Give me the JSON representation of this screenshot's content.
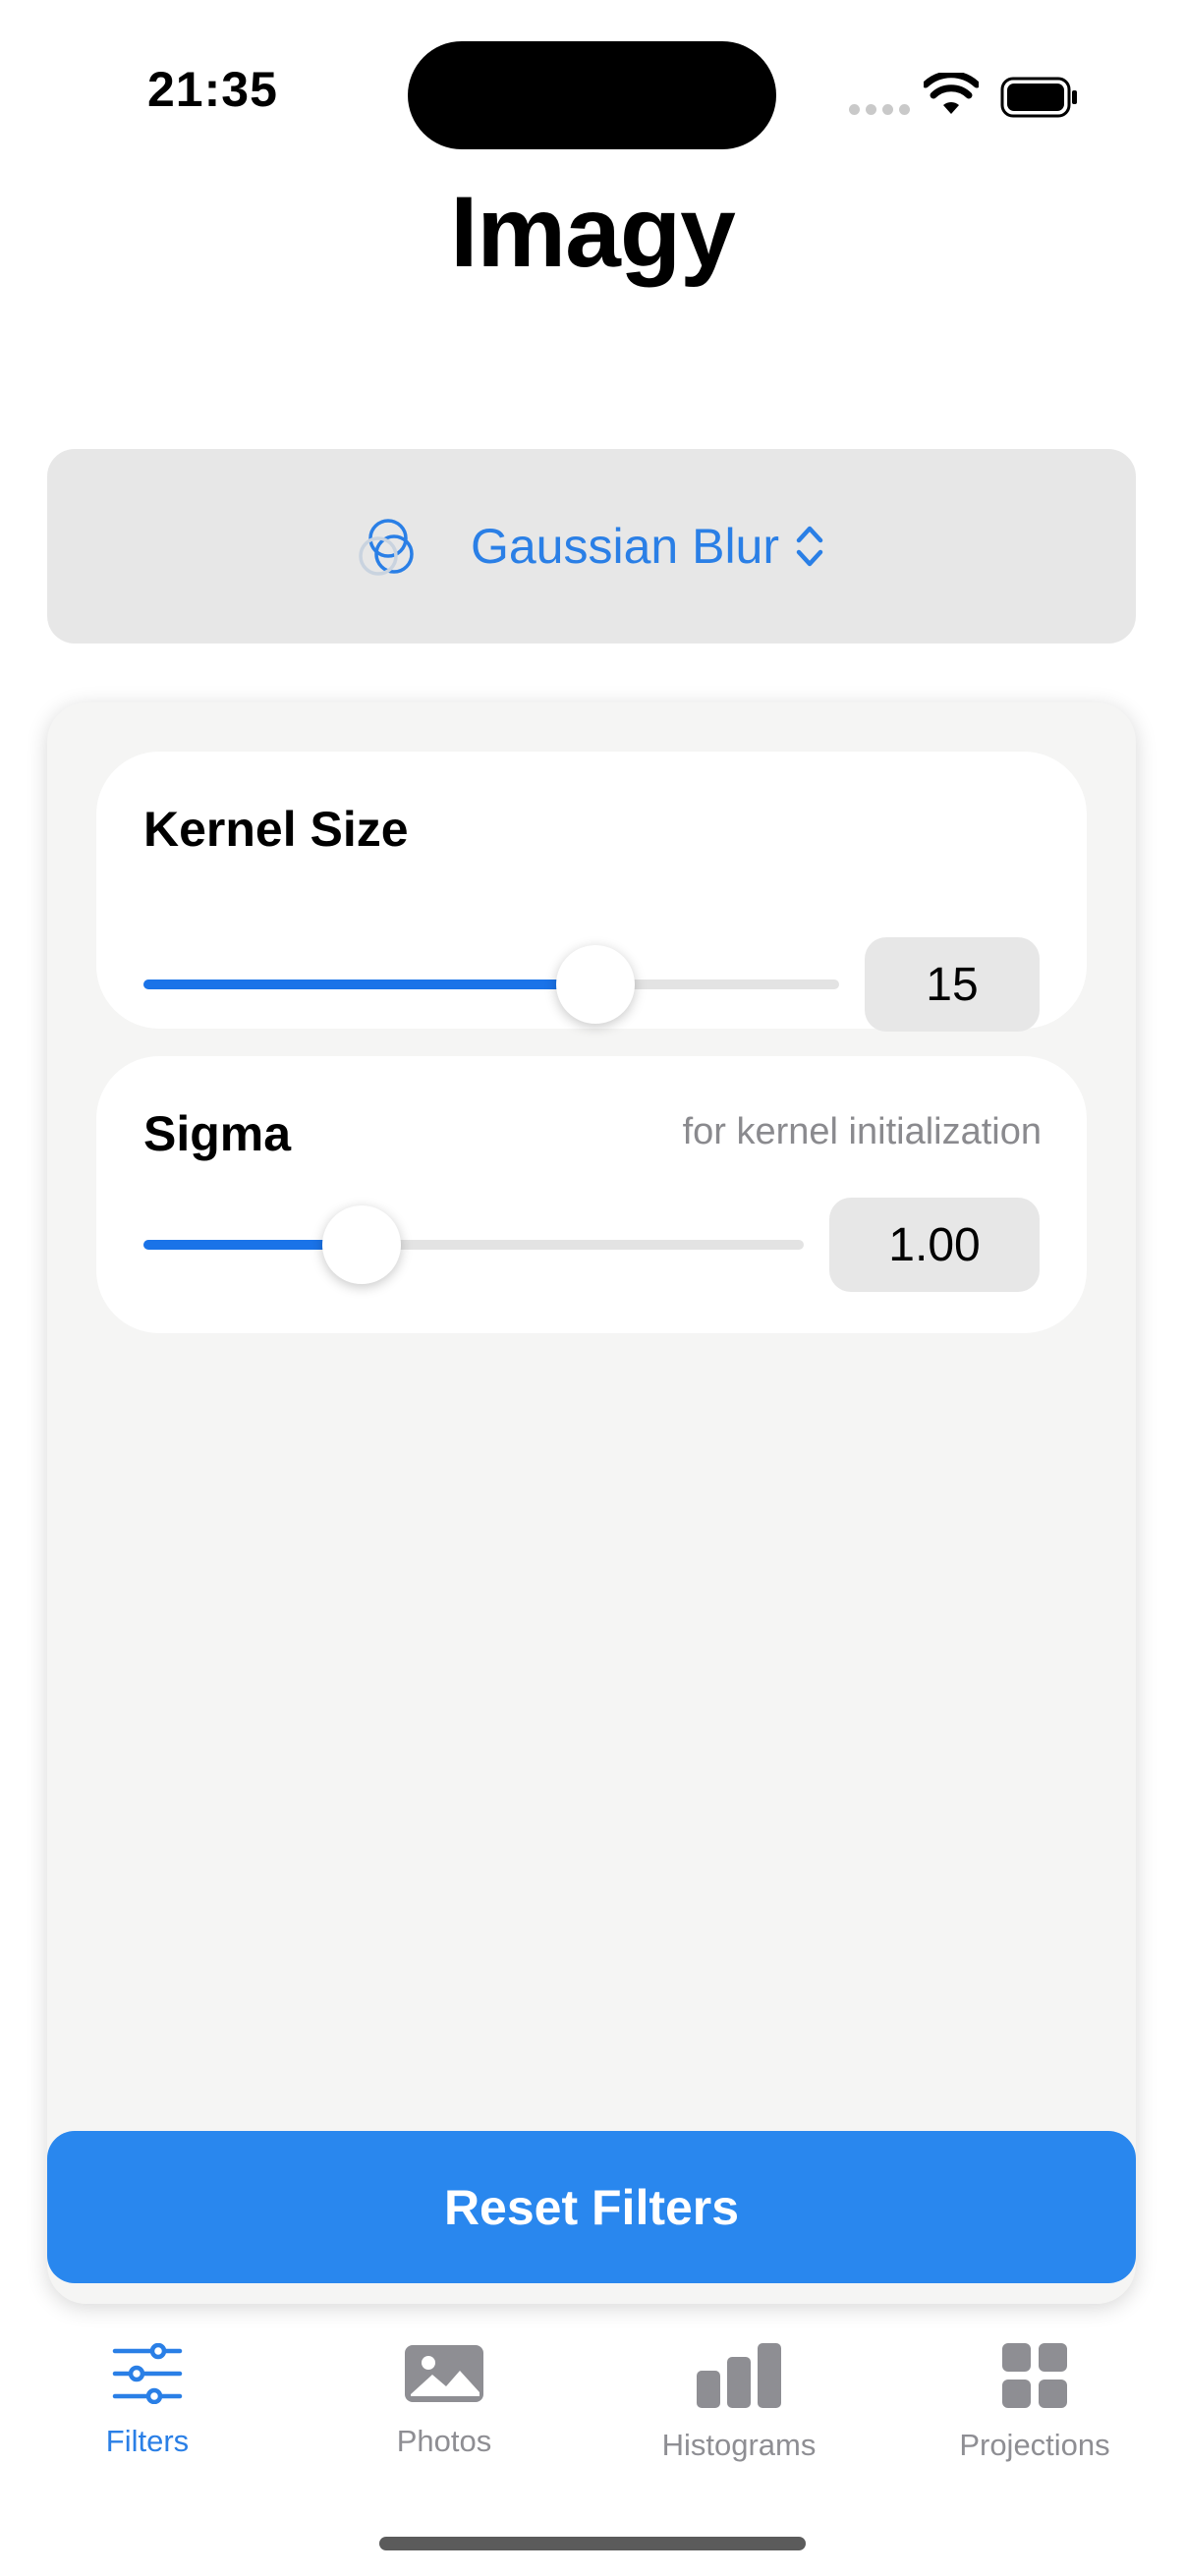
{
  "status_bar": {
    "time": "21:35"
  },
  "app": {
    "title": "Imagy"
  },
  "filter_selector": {
    "label": "Gaussian Blur",
    "icon": "blur-circles-icon"
  },
  "params": {
    "kernel_size": {
      "title": "Kernel Size",
      "value": "15",
      "slider_fraction": 0.65
    },
    "sigma": {
      "title": "Sigma",
      "subtitle": "for kernel initialization",
      "value": "1.00",
      "slider_fraction": 0.33
    }
  },
  "reset_button": {
    "label": "Reset Filters"
  },
  "tabs": [
    {
      "label": "Filters",
      "icon": "sliders-icon",
      "active": true
    },
    {
      "label": "Photos",
      "icon": "photo-icon",
      "active": false
    },
    {
      "label": "Histograms",
      "icon": "bar-chart-icon",
      "active": false
    },
    {
      "label": "Projections",
      "icon": "grid-icon",
      "active": false
    }
  ],
  "colors": {
    "accent": "#2A7FE6",
    "button": "#2987EE",
    "inactive_tab": "#8E8E93"
  }
}
